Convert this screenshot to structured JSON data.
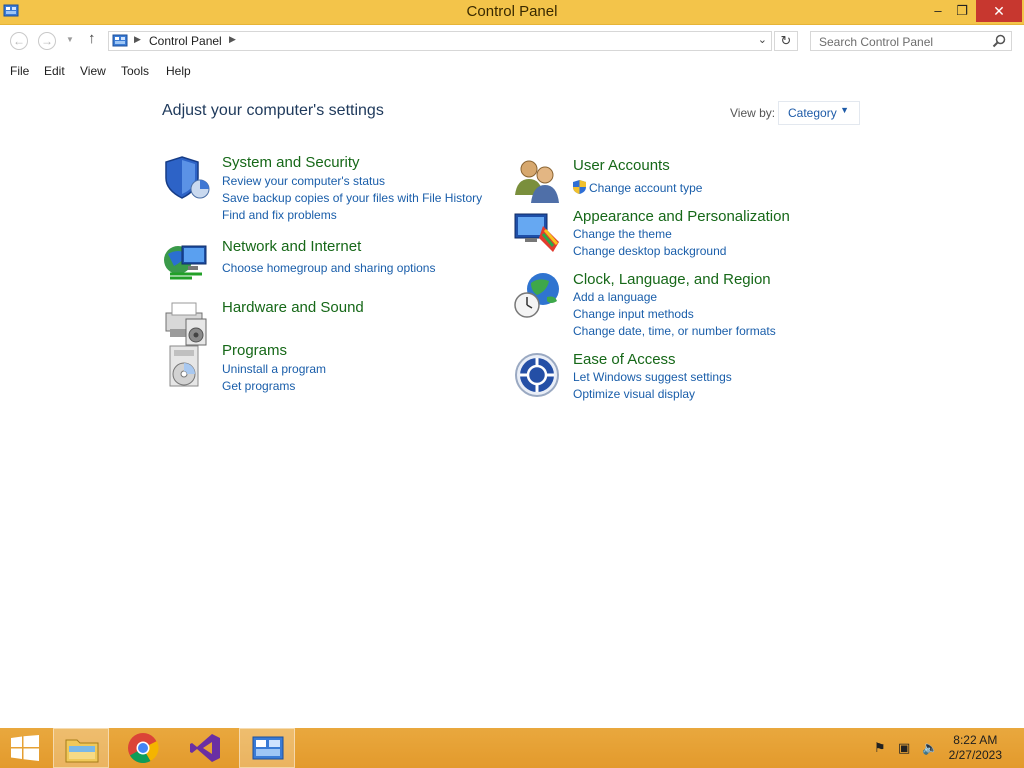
{
  "window": {
    "title": "Control Panel",
    "controls": {
      "minimize": "–",
      "maximize": "❐",
      "close": "✕"
    }
  },
  "address_bar": {
    "breadcrumb": "Control Panel",
    "search_placeholder": "Search Control Panel"
  },
  "menu": [
    "File",
    "Edit",
    "View",
    "Tools",
    "Help"
  ],
  "main": {
    "heading": "Adjust your computer's settings",
    "view_by_label": "View by:",
    "view_by_value": "Category"
  },
  "categories_left": [
    {
      "title": "System and Security",
      "icon": "shield-icon",
      "links": [
        "Review your computer's status",
        "Save backup copies of your files with File History",
        "Find and fix problems"
      ]
    },
    {
      "title": "Network and Internet",
      "icon": "network-globe-icon",
      "links": [
        "Choose homegroup and sharing options"
      ]
    },
    {
      "title": "Hardware and Sound",
      "icon": "printer-speaker-icon",
      "links": []
    },
    {
      "title": "Programs",
      "icon": "programs-disc-icon",
      "links": [
        "Uninstall a program",
        "Get programs"
      ]
    }
  ],
  "categories_right": [
    {
      "title": "User Accounts",
      "icon": "users-icon",
      "links": [
        "Change account type"
      ]
    },
    {
      "title": "Appearance and Personalization",
      "icon": "monitor-palette-icon",
      "links": [
        "Change the theme",
        "Change desktop background"
      ]
    },
    {
      "title": "Clock, Language, and Region",
      "icon": "clock-globe-icon",
      "links": [
        "Add a language",
        "Change input methods",
        "Change date, time, or number formats"
      ]
    },
    {
      "title": "Ease of Access",
      "icon": "ease-of-access-icon",
      "links": [
        "Let Windows suggest settings",
        "Optimize visual display"
      ]
    }
  ],
  "taskbar": {
    "apps": [
      "start-button",
      "file-explorer",
      "chrome",
      "visual-studio",
      "control-panel"
    ],
    "clock_time": "8:22 AM",
    "clock_date": "2/27/2023"
  },
  "colors": {
    "titlebar": "#f3c44a",
    "taskbar": "#e5a033",
    "category_title": "#166818",
    "link": "#1a5eaa",
    "heading": "#1e395b"
  }
}
